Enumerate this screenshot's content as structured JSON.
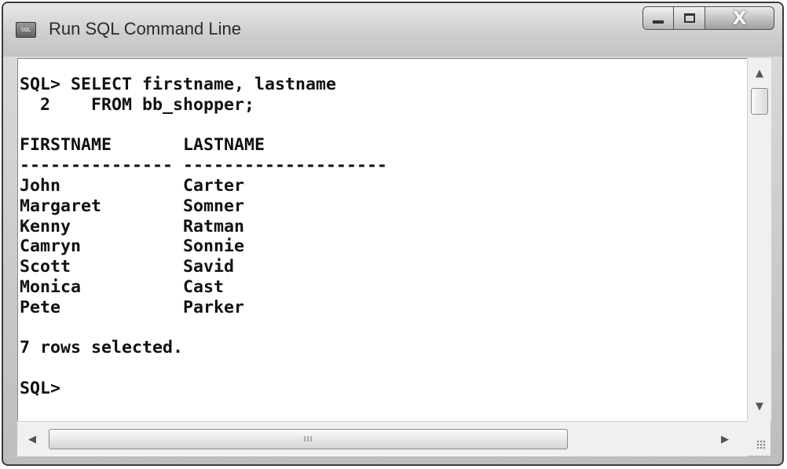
{
  "window": {
    "title": "Run SQL Command Line",
    "icon_name": "sql-app-icon",
    "icon_text": "SQL"
  },
  "controls": {
    "minimize_icon": "minimize-icon",
    "maximize_icon": "maximize-icon",
    "close_label": "X"
  },
  "console": {
    "lines": [
      "SQL> SELECT firstname, lastname",
      "  2    FROM bb_shopper;",
      "",
      "FIRSTNAME       LASTNAME",
      "--------------- --------------------",
      "John            Carter",
      "Margaret        Somner",
      "Kenny           Ratman",
      "Camryn          Sonnie",
      "Scott           Savid",
      "Monica          Cast",
      "Pete            Parker",
      "",
      "7 rows selected.",
      "",
      "SQL>"
    ]
  },
  "scrollbars": {
    "up_arrow": "▲",
    "down_arrow": "▼",
    "left_arrow": "◀",
    "right_arrow": "▶",
    "thumb_grip": "III"
  },
  "colors": {
    "console_background": "#ffffff",
    "console_text": "#111111",
    "frame": "#c8c8c8"
  }
}
